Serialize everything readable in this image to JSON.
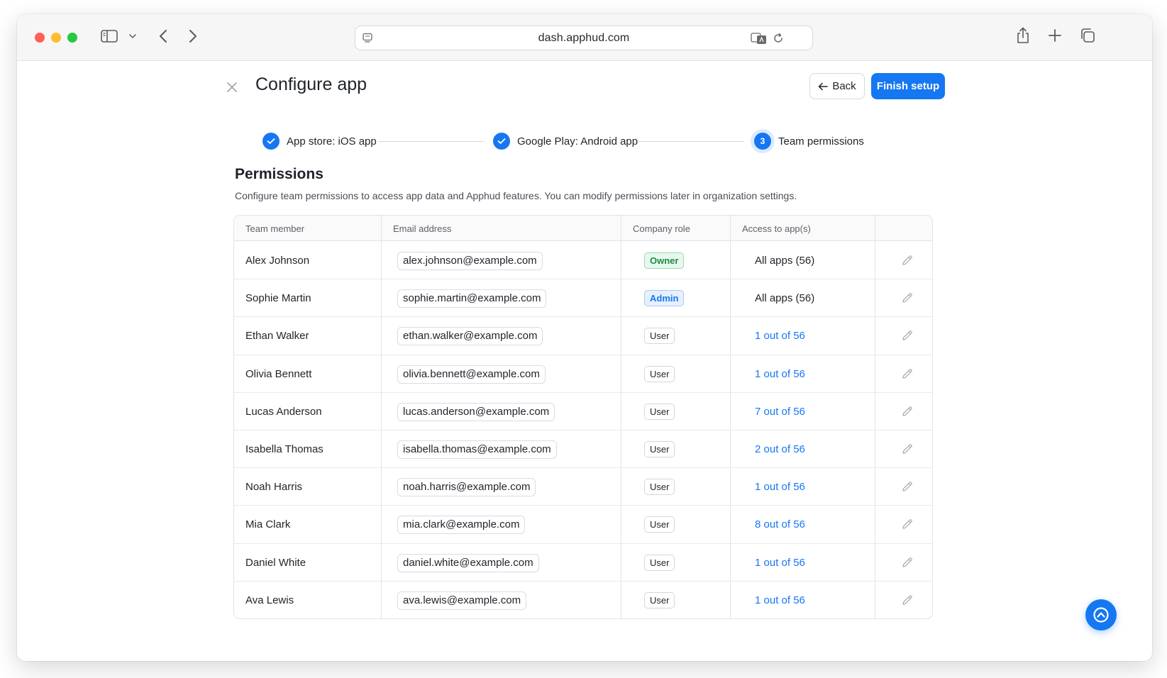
{
  "browser": {
    "url": "dash.apphud.com"
  },
  "header": {
    "title": "Configure app",
    "back_label": "Back",
    "finish_label": "Finish setup"
  },
  "steps": [
    {
      "label": "App store: iOS app",
      "state": "done"
    },
    {
      "label": "Google Play: Android app",
      "state": "done"
    },
    {
      "label": "Team permissions",
      "state": "current",
      "number": "3"
    }
  ],
  "permissions": {
    "title": "Permissions",
    "description": "Configure team permissions to access app data and Apphud features. You can modify permissions later in organization settings.",
    "columns": [
      "Team member",
      "Email address",
      "Company role",
      "Access to app(s)"
    ],
    "rows": [
      {
        "name": "Alex Johnson",
        "email": "alex.johnson@example.com",
        "role": "Owner",
        "access": "All apps (56)"
      },
      {
        "name": "Sophie Martin",
        "email": "sophie.martin@example.com",
        "role": "Admin",
        "access": "All apps (56)"
      },
      {
        "name": "Ethan Walker",
        "email": "ethan.walker@example.com",
        "role": "User",
        "access": "1 out of 56"
      },
      {
        "name": "Olivia Bennett",
        "email": "olivia.bennett@example.com",
        "role": "User",
        "access": "1 out of 56"
      },
      {
        "name": "Lucas Anderson",
        "email": "lucas.anderson@example.com",
        "role": "User",
        "access": "7 out of 56"
      },
      {
        "name": "Isabella Thomas",
        "email": "isabella.thomas@example.com",
        "role": "User",
        "access": "2 out of 56"
      },
      {
        "name": "Noah Harris",
        "email": "noah.harris@example.com",
        "role": "User",
        "access": "1 out of 56"
      },
      {
        "name": "Mia Clark",
        "email": "mia.clark@example.com",
        "role": "User",
        "access": "8 out of 56"
      },
      {
        "name": "Daniel White",
        "email": "daniel.white@example.com",
        "role": "User",
        "access": "1 out of 56"
      },
      {
        "name": "Ava Lewis",
        "email": "ava.lewis@example.com",
        "role": "User",
        "access": "1 out of 56"
      }
    ]
  },
  "colors": {
    "accent": "#1677f2",
    "owner_green": "#1c8b44",
    "close_red": "#ff5f57",
    "minimize_yellow": "#febc2e",
    "zoom_green": "#28c840"
  }
}
